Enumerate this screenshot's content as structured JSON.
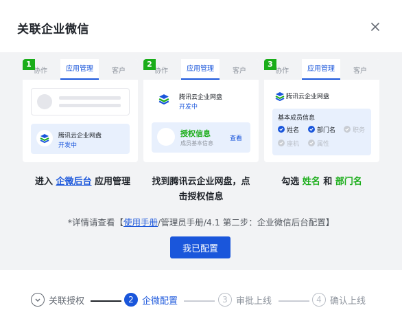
{
  "dialog": {
    "title": "关联企业微信"
  },
  "cards": [
    {
      "num": "1",
      "tabs": [
        "协作",
        "应用管理",
        "客户"
      ],
      "app_name": "腾讯云企业网盘",
      "app_status": "开发中"
    },
    {
      "num": "2",
      "tabs": [
        "协作",
        "应用管理",
        "客户"
      ],
      "app_name": "腾讯云企业网盘",
      "app_status": "开发中",
      "auth_title": "授权信息",
      "auth_sub": "成员基本信息",
      "auth_link": "查看"
    },
    {
      "num": "3",
      "tabs": [
        "协作",
        "应用管理",
        "客户"
      ],
      "app_name": "腾讯云企业网盘",
      "info_title": "基本成员信息",
      "fields": [
        {
          "label": "姓名",
          "checked": true
        },
        {
          "label": "部门名",
          "checked": true
        },
        {
          "label": "职务",
          "checked": false
        },
        {
          "label": "座机",
          "checked": false
        },
        {
          "label": "属性",
          "checked": false
        }
      ]
    }
  ],
  "steps_text": {
    "s1_pre": "进入 ",
    "s1_link": "企微后台",
    "s1_post": " 应用管理",
    "s2_line1": "找到腾讯云企业网盘，点",
    "s2_line2": "击授权信息",
    "s3_pre": "勾选 ",
    "s3_a": "姓名",
    "s3_mid": " 和 ",
    "s3_b": "部门名"
  },
  "note": {
    "pre": "*详情请查看【",
    "link": "使用手册",
    "post": "/管理员手册/4.1 第二步：企业微信后台配置】"
  },
  "confirm_button": "我已配置",
  "stepper": [
    {
      "num": "✓",
      "label": "关联授权",
      "state": "done"
    },
    {
      "num": "2",
      "label": "企微配置",
      "state": "active"
    },
    {
      "num": "3",
      "label": "审批上线",
      "state": "todo"
    },
    {
      "num": "4",
      "label": "确认上线",
      "state": "todo"
    }
  ],
  "colors": {
    "primary": "#1a56db",
    "green": "#1aad19"
  }
}
